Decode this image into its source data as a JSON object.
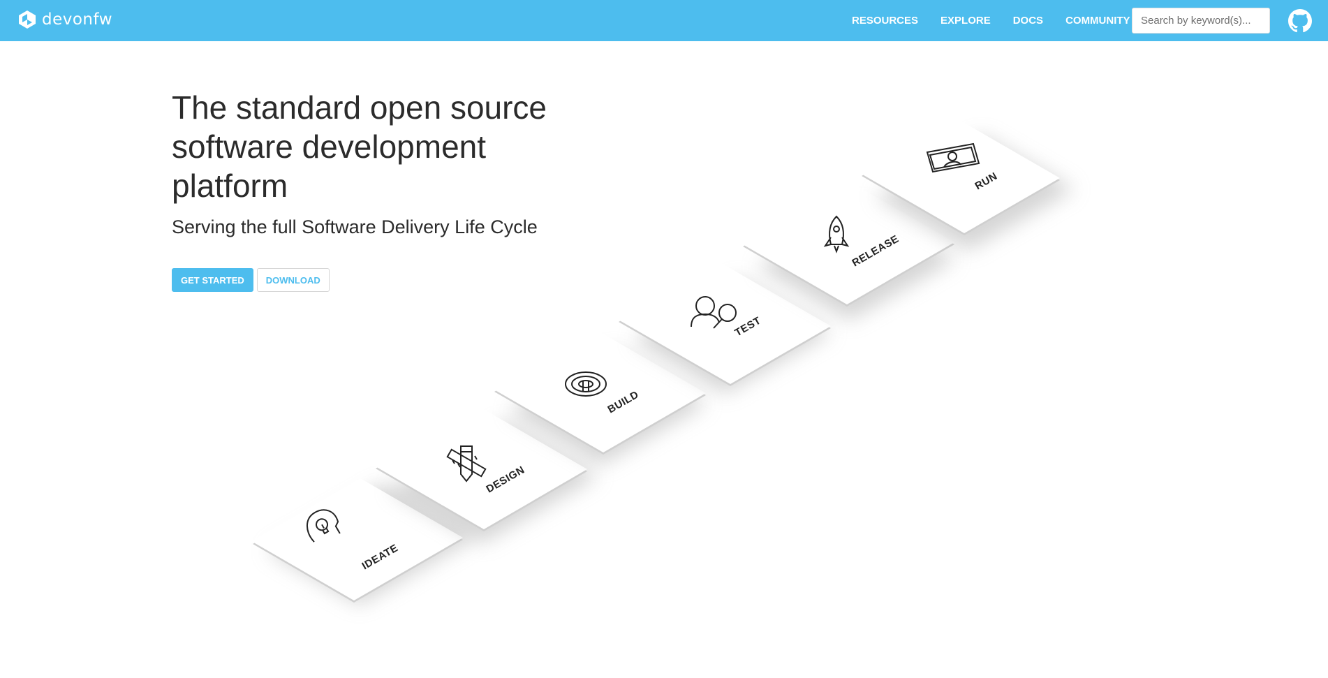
{
  "navbar": {
    "brand": "devonfw",
    "links": [
      "RESOURCES",
      "EXPLORE",
      "DOCS",
      "COMMUNITY"
    ],
    "search": {
      "placeholder": "Search by keyword(s)...",
      "value": ""
    },
    "github_icon": "github-icon",
    "background": "#4dbdee"
  },
  "hero": {
    "title": "The standard open source software development platform",
    "subtitle": "Serving the full Software Delivery Life Cycle",
    "buttons": {
      "primary": "GET STARTED",
      "secondary": "DOWNLOAD"
    }
  },
  "steps": [
    {
      "label": "IDEATE",
      "icon": "lightbulb-head-icon"
    },
    {
      "label": "DESIGN",
      "icon": "pencil-ruler-icon"
    },
    {
      "label": "BUILD",
      "icon": "maze-icon"
    },
    {
      "label": "TEST",
      "icon": "person-magnifier-icon"
    },
    {
      "label": "RELEASE",
      "icon": "rocket-icon"
    },
    {
      "label": "RUN",
      "icon": "monitor-person-icon"
    }
  ],
  "colors": {
    "accent": "#4dbdee",
    "text": "#2b2b2b"
  }
}
